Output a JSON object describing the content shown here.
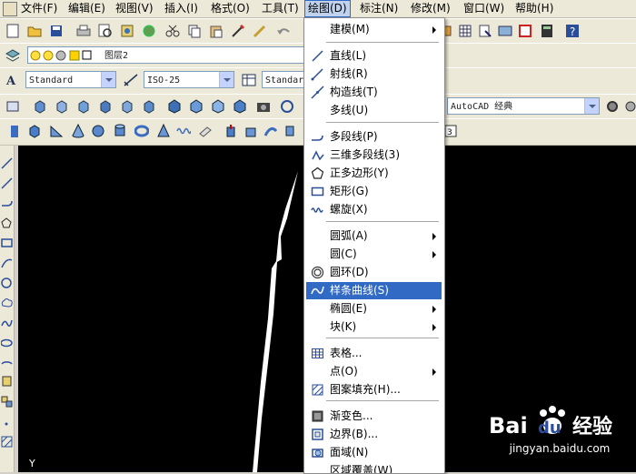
{
  "menubar": {
    "items": [
      "文件(F)",
      "编辑(E)",
      "视图(V)",
      "插入(I)",
      "格式(O)",
      "工具(T)",
      "绘图(D)",
      "标注(N)",
      "修改(M)",
      "窗口(W)",
      "帮助(H)"
    ],
    "active": "绘图(D)"
  },
  "toolbar_layers": {
    "layer_value": "图层2"
  },
  "toolbar_styles": {
    "text_style": "Standard",
    "dim_style": "ISO-25",
    "table_style": "Standard"
  },
  "workspace": {
    "value": "AutoCAD 经典"
  },
  "draw_menu": {
    "items": [
      {
        "label": "建模(M)",
        "submenu": true,
        "icon": ""
      },
      {
        "label": "直线(L)",
        "submenu": false,
        "icon": "line-icon"
      },
      {
        "label": "射线(R)",
        "submenu": false,
        "icon": "ray-icon"
      },
      {
        "label": "构造线(T)",
        "submenu": false,
        "icon": "construction-line-icon"
      },
      {
        "label": "多线(U)",
        "submenu": false,
        "icon": ""
      },
      {
        "label": "多段线(P)",
        "submenu": false,
        "icon": "polyline-icon"
      },
      {
        "label": "三维多段线(3)",
        "submenu": false,
        "icon": "3d-polyline-icon"
      },
      {
        "label": "正多边形(Y)",
        "submenu": false,
        "icon": "polygon-icon"
      },
      {
        "label": "矩形(G)",
        "submenu": false,
        "icon": "rectangle-icon"
      },
      {
        "label": "螺旋(X)",
        "submenu": false,
        "icon": "helix-icon"
      },
      {
        "label": "圆弧(A)",
        "submenu": true,
        "icon": ""
      },
      {
        "label": "圆(C)",
        "submenu": true,
        "icon": ""
      },
      {
        "label": "圆环(D)",
        "submenu": false,
        "icon": "donut-icon"
      },
      {
        "label": "样条曲线(S)",
        "submenu": false,
        "icon": "spline-icon",
        "highlighted": true
      },
      {
        "label": "椭圆(E)",
        "submenu": true,
        "icon": ""
      },
      {
        "label": "块(K)",
        "submenu": true,
        "icon": ""
      },
      {
        "label": "表格...",
        "submenu": false,
        "icon": "table-icon"
      },
      {
        "label": "点(O)",
        "submenu": true,
        "icon": ""
      },
      {
        "label": "图案填充(H)...",
        "submenu": false,
        "icon": "hatch-icon"
      },
      {
        "label": "渐变色...",
        "submenu": false,
        "icon": "gradient-icon"
      },
      {
        "label": "边界(B)...",
        "submenu": false,
        "icon": "boundary-icon"
      },
      {
        "label": "面域(N)",
        "submenu": false,
        "icon": "region-icon"
      },
      {
        "label": "区域覆盖(W)",
        "submenu": false,
        "icon": ""
      }
    ]
  },
  "canvas": {
    "axis_label": "Y"
  },
  "watermark": {
    "brand": "Bai du 经验",
    "url": "jingyan.baidu.com"
  },
  "colors": {
    "menu_highlight": "#316ac5",
    "canvas_bg": "#000000",
    "toolbar_bg": "#ece9d8"
  }
}
